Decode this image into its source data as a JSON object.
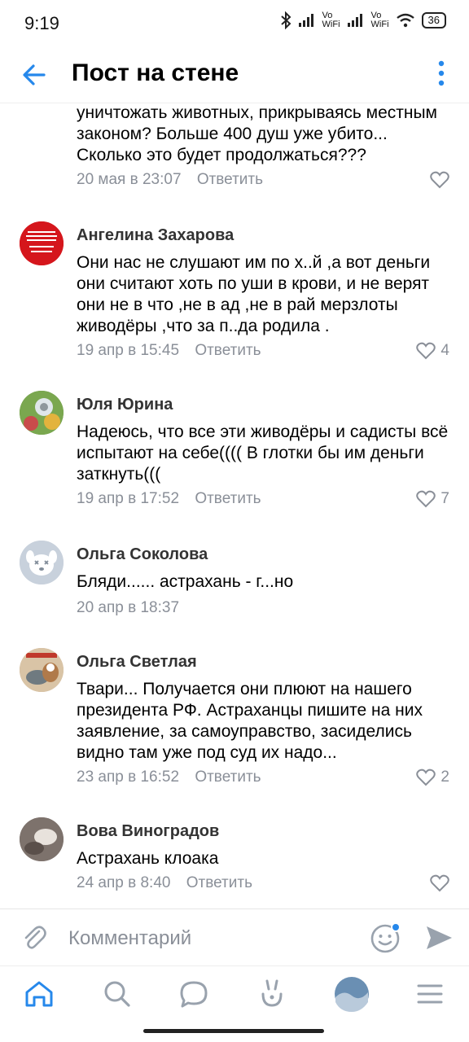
{
  "status_bar": {
    "time": "9:19",
    "network_1": "Vo WiFi",
    "network_2": "Vo WiFi",
    "battery": "36"
  },
  "header": {
    "title": "Пост на стене"
  },
  "comments": [
    {
      "author": "",
      "text": "уничтожать животных, прикрываясь местным законом? Больше 400 душ уже убито... Сколько это будет продолжаться???",
      "date": "20 мая в 23:07",
      "reply_label": "Ответить",
      "likes": ""
    },
    {
      "author": "Ангелина Захарова",
      "text": "Они нас не слушают им по х..й ,а вот деньги они считают хоть по уши в крови, и не верят они не в что ,не в ад ,не в рай  мерзлоты живодёры ,что за п..да родила .",
      "date": "19 апр в 15:45",
      "reply_label": "Ответить",
      "likes": "4",
      "avatar_text": "НЕТ МАССОВОМУ УБИЙСТВУ ЖИВОТНЫХ! ЭВТАНАЗИЯ = УБИЙСТВО!"
    },
    {
      "author": "Юля Юрина",
      "text": "Надеюсь, что все эти живодёры и садисты всё испытают на себе(((( В глотки бы им деньги заткнуть(((",
      "date": "19 апр в 17:52",
      "reply_label": "Ответить",
      "likes": "7"
    },
    {
      "author": "Ольга Соколова",
      "text": "Бляди...... астрахань - г...но",
      "date": "20 апр в 18:37",
      "reply_label": "",
      "likes": ""
    },
    {
      "author": "Ольга Светлая",
      "text": "Твари... Получается они плюют на нашего президента РФ. Астраханцы пишите на них заявление, за самоуправство, засиделись видно там уже  под суд их надо...",
      "date": "23 апр в 16:52",
      "reply_label": "Ответить",
      "likes": "2"
    },
    {
      "author": "Вова Виноградов",
      "text": "Астрахань клоака",
      "date": "24 апр в 8:40",
      "reply_label": "Ответить",
      "likes": ""
    }
  ],
  "composer": {
    "placeholder": "Комментарий"
  },
  "colors": {
    "accent": "#2688eb",
    "secondary_text": "#8a8f98"
  }
}
